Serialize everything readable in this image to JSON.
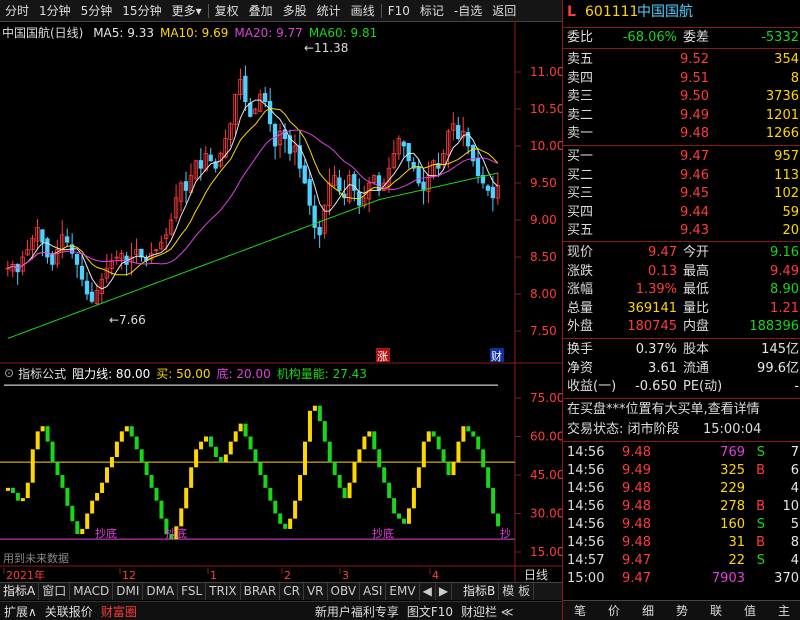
{
  "toolbar": {
    "items": [
      "分时",
      "1分钟",
      "5分钟",
      "15分钟",
      "更多▾",
      "复权",
      "叠加",
      "多股",
      "统计",
      "画线",
      "F10",
      "标记",
      "-自选",
      "返回"
    ]
  },
  "chart": {
    "stock_title": "中国国航(日线)",
    "ma": [
      {
        "label": "MA5: 9.33",
        "color": "#e6e6e6"
      },
      {
        "label": "MA10: 9.69",
        "color": "#ffd700"
      },
      {
        "label": "MA20: 9.77",
        "color": "#e040e0"
      },
      {
        "label": "MA60: 9.81",
        "color": "#19d619"
      }
    ],
    "high_marker": "11.38",
    "low_marker": "7.66",
    "price_ticks": [
      "11.00",
      "10.50",
      "10.00",
      "9.50",
      "9.00",
      "8.50",
      "8.00",
      "7.50"
    ],
    "tag_zhang": "涨",
    "tag_cai": "财",
    "dates": [
      "2021年",
      "12",
      "1",
      "2",
      "3",
      "4"
    ],
    "period": "日线"
  },
  "indicator": {
    "name": "指标公式",
    "resist": "阻力线: 80.00",
    "buy": "买: 50.00",
    "bottom": "底: 20.00",
    "inst": "机构量能: 27.43",
    "ticks": [
      "75.00",
      "60.00",
      "45.00",
      "30.00",
      "15.00"
    ],
    "future_note": "用到未来数据",
    "chaodi": "抄底",
    "chao": "抄"
  },
  "tabs": [
    "指标A",
    "窗口",
    "MACD",
    "DMI",
    "DMA",
    "FSL",
    "TRIX",
    "BRAR",
    "CR",
    "VR",
    "OBV",
    "ASI",
    "EMV",
    "◀",
    "▶",
    "指标B",
    "模 板"
  ],
  "statusbar": [
    "扩展∧",
    "关联报价",
    "财富圈",
    "新用户福利专享",
    "图文F10",
    "财迎栏 ≪"
  ],
  "quote": {
    "market": "L",
    "code": "601111",
    "name": "中国国航",
    "webi_label": "委比",
    "webi": "-68.06%",
    "wecha_label": "委差",
    "wecha": "-5332",
    "sells": [
      {
        "label": "卖五",
        "price": "9.52",
        "vol": "354"
      },
      {
        "label": "卖四",
        "price": "9.51",
        "vol": "8"
      },
      {
        "label": "卖三",
        "price": "9.50",
        "vol": "3736"
      },
      {
        "label": "卖二",
        "price": "9.49",
        "vol": "1201"
      },
      {
        "label": "卖一",
        "price": "9.48",
        "vol": "1266"
      }
    ],
    "buys": [
      {
        "label": "买一",
        "price": "9.47",
        "vol": "957"
      },
      {
        "label": "买二",
        "price": "9.46",
        "vol": "113"
      },
      {
        "label": "买三",
        "price": "9.45",
        "vol": "102"
      },
      {
        "label": "买四",
        "price": "9.44",
        "vol": "59"
      },
      {
        "label": "买五",
        "price": "9.43",
        "vol": "20"
      }
    ],
    "stats": [
      {
        "l1": "现价",
        "v1": "9.47",
        "c1": "red",
        "l2": "今开",
        "v2": "9.16",
        "c2": "green"
      },
      {
        "l1": "涨跌",
        "v1": "0.13",
        "c1": "red",
        "l2": "最高",
        "v2": "9.49",
        "c2": "red"
      },
      {
        "l1": "涨幅",
        "v1": "1.39%",
        "c1": "red",
        "l2": "最低",
        "v2": "8.90",
        "c2": "green"
      },
      {
        "l1": "总量",
        "v1": "369141",
        "c1": "yellow",
        "l2": "量比",
        "v2": "1.21",
        "c2": "red"
      },
      {
        "l1": "外盘",
        "v1": "180745",
        "c1": "red",
        "l2": "内盘",
        "v2": "188396",
        "c2": "green"
      }
    ],
    "stats2": [
      {
        "l1": "换手",
        "v1": "0.37%",
        "l2": "股本",
        "v2": "145亿"
      },
      {
        "l1": "净资",
        "v1": "3.61",
        "l2": "流通",
        "v2": "99.6亿"
      },
      {
        "l1": "收益(一)",
        "v1": "-0.650",
        "l2": "PE(动)",
        "v2": "-"
      }
    ],
    "notice": "在买盘***位置有大买单,查看详情",
    "trade_status_label": "交易状态: 闭市阶段",
    "trade_time": "15:00:04",
    "ticks": [
      {
        "t": "14:56",
        "p": "9.48",
        "v": "769",
        "vc": "magenta",
        "bs": "S",
        "bc": "green",
        "n": "7"
      },
      {
        "t": "14:56",
        "p": "9.49",
        "v": "325",
        "vc": "yellow",
        "bs": "B",
        "bc": "red",
        "n": "6"
      },
      {
        "t": "14:56",
        "p": "9.48",
        "v": "229",
        "vc": "yellow",
        "bs": "",
        "bc": "white",
        "n": "4"
      },
      {
        "t": "14:56",
        "p": "9.48",
        "v": "278",
        "vc": "yellow",
        "bs": "B",
        "bc": "red",
        "n": "10"
      },
      {
        "t": "14:56",
        "p": "9.48",
        "v": "160",
        "vc": "yellow",
        "bs": "S",
        "bc": "green",
        "n": "5"
      },
      {
        "t": "14:56",
        "p": "9.48",
        "v": "31",
        "vc": "yellow",
        "bs": "B",
        "bc": "red",
        "n": "8"
      },
      {
        "t": "14:57",
        "p": "9.47",
        "v": "22",
        "vc": "yellow",
        "bs": "S",
        "bc": "green",
        "n": "4"
      },
      {
        "t": "15:00",
        "p": "9.47",
        "v": "7903",
        "vc": "magenta",
        "bs": "",
        "bc": "white",
        "n": "370"
      }
    ],
    "bottom_icons": [
      "笔",
      "价",
      "细",
      "势",
      "联",
      "值",
      "主"
    ]
  }
}
